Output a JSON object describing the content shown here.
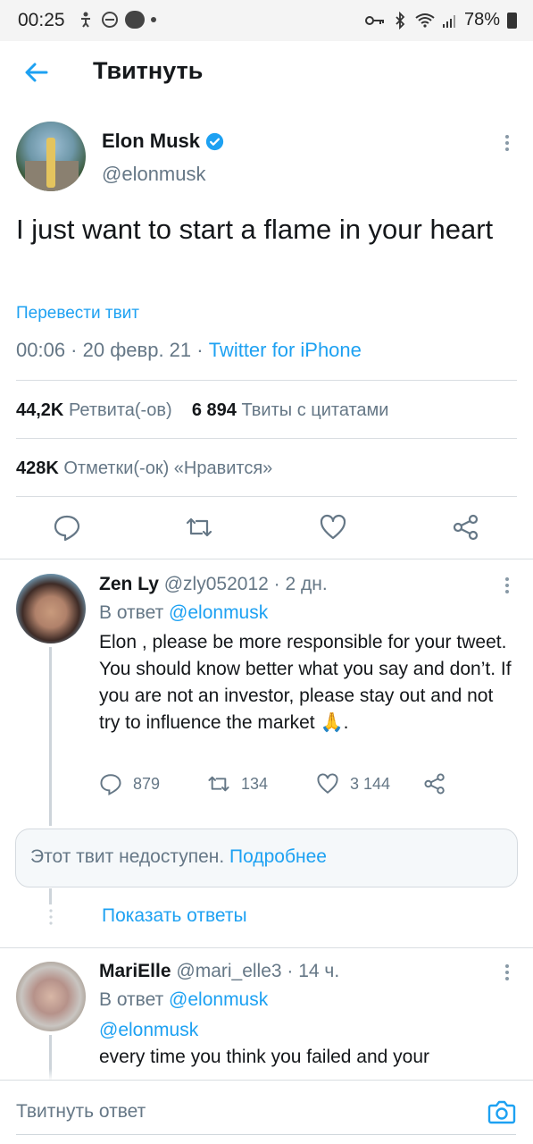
{
  "status_bar": {
    "time": "00:25",
    "battery": "78%"
  },
  "header": {
    "title": "Твитнуть"
  },
  "tweet": {
    "author_name": "Elon Musk",
    "author_handle": "@elonmusk",
    "verified": true,
    "text": "I just want to start a flame in your heart",
    "translate_label": "Перевести твит",
    "time_date": "00:06 · 20 февр. 21 · ",
    "source": "Twitter for iPhone",
    "retweets_count": "44,2K",
    "retweets_label": "Ретвита(-ов)",
    "quotes_count": "6 894",
    "quotes_label": "Твиты с цитатами",
    "likes_count": "428K",
    "likes_label": "Отметки(-ок) «Нравится»"
  },
  "replies": [
    {
      "name": "Zen Ly",
      "handle_time": " @zly052012 · 2 дн.",
      "reply_to_prefix": "В ответ ",
      "reply_to": "@elonmusk",
      "text": "Elon , please be more responsible for your tweet.  You should know better what you say and don’t.  If you are not an investor, please stay out and not try to influence the market 🙏.",
      "replies_count": "879",
      "retweets_count": "134",
      "likes_count": "3 144"
    },
    {
      "name": "MariElle",
      "handle_time": " @mari_elle3 · 14 ч.",
      "reply_to_prefix": "В ответ ",
      "reply_to": "@elonmusk",
      "mention": "@elonmusk",
      "text": "every time you think you failed and your"
    }
  ],
  "unavailable": {
    "text": "Этот твит недоступен. ",
    "link": "Подробнее"
  },
  "show_replies": "Показать ответы",
  "composer": {
    "placeholder": "Твитнуть ответ"
  },
  "colors": {
    "accent": "#1da1f2",
    "secondary_text": "#657786",
    "primary_text": "#14171a"
  }
}
